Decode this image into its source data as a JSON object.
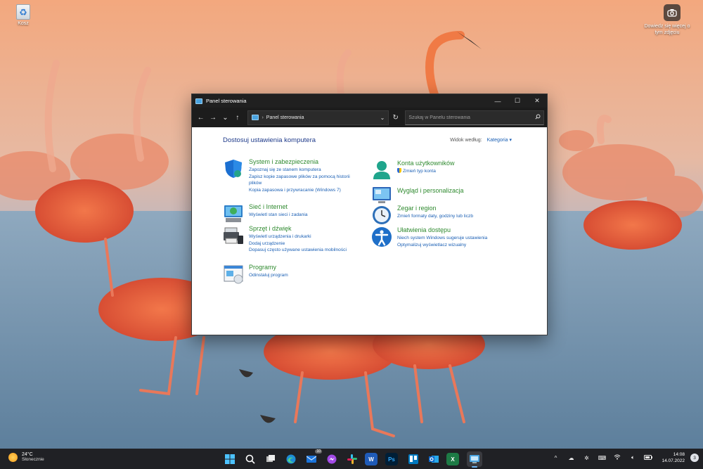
{
  "desktop": {
    "recycle_bin_label": "Kosz",
    "spotlight_label": "Dowiedz się więcej o tym zdjęciu",
    "icons": [
      "recycle-bin-icon",
      "camera-icon"
    ]
  },
  "window": {
    "title": "Panel sterowania",
    "controls": {
      "minimize": "—",
      "maximize": "☐",
      "close": "✕"
    },
    "nav": {
      "back": "←",
      "forward": "→",
      "recent": "⌄",
      "up": "↑"
    },
    "address": {
      "separator": "›",
      "crumb": "Panel sterowania",
      "dropdown": "⌄"
    },
    "refresh": "↻",
    "search": {
      "placeholder": "Szukaj w Panelu sterowania"
    },
    "heading": "Dostosuj ustawienia komputera",
    "view_by": {
      "label": "Widok według:",
      "value": "Kategoria ▾"
    }
  },
  "categories": {
    "system": {
      "title": "System i zabezpieczenia",
      "links": [
        "Zapoznaj się ze stanem komputera",
        "Zapisz kopie zapasowe plików za pomocą historii plików",
        "Kopia zapasowa i przywracanie (Windows 7)"
      ]
    },
    "network": {
      "title": "Sieć i Internet",
      "links": [
        "Wyświetl stan sieci i zadania"
      ]
    },
    "hardware": {
      "title": "Sprzęt i dźwięk",
      "links": [
        "Wyświetl urządzenia i drukarki",
        "Dodaj urządzenie",
        "Dopasuj często używane ustawienia mobilności"
      ]
    },
    "programs": {
      "title": "Programy",
      "links": [
        "Odinstaluj program"
      ]
    },
    "accounts": {
      "title": "Konta użytkowników",
      "links": [
        "Zmień typ konta"
      ]
    },
    "appearance": {
      "title": "Wygląd i personalizacja",
      "links": []
    },
    "clock": {
      "title": "Zegar i region",
      "links": [
        "Zmień formaty daty, godziny lub liczb"
      ]
    },
    "access": {
      "title": "Ułatwienia dostępu",
      "links": [
        "Niech system Windows sugeruje ustawienia",
        "Optymalizuj wyświetlacz wizualny"
      ]
    }
  },
  "taskbar": {
    "weather": {
      "temp": "24°C",
      "condition": "Słonecznie"
    },
    "apps": [
      {
        "name": "start",
        "icon": "windows-icon"
      },
      {
        "name": "search",
        "icon": "search-icon"
      },
      {
        "name": "task-view",
        "icon": "task-view-icon"
      },
      {
        "name": "edge",
        "icon": "edge-icon"
      },
      {
        "name": "mail",
        "icon": "mail-icon",
        "badge": "10"
      },
      {
        "name": "messenger",
        "icon": "messenger-icon"
      },
      {
        "name": "slack",
        "icon": "slack-icon"
      },
      {
        "name": "word",
        "icon": "word-icon",
        "label": "W"
      },
      {
        "name": "photoshop",
        "icon": "photoshop-icon",
        "label": "Ps"
      },
      {
        "name": "trello",
        "icon": "trello-icon"
      },
      {
        "name": "outlook",
        "icon": "outlook-icon"
      },
      {
        "name": "excel",
        "icon": "excel-icon",
        "label": "X"
      },
      {
        "name": "control-panel",
        "icon": "control-panel-icon"
      }
    ],
    "tray": [
      "chevron-up-icon",
      "onedrive-icon",
      "slack-tray-icon",
      "keyboard-icon",
      "wifi-icon",
      "speaker-icon",
      "battery-icon"
    ],
    "time": "14:08",
    "date": "14.07.2022",
    "notifications": "3"
  }
}
